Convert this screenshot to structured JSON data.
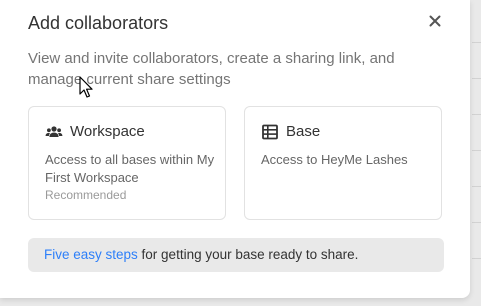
{
  "dialog": {
    "title": "Add collaborators",
    "close_icon": "close-icon",
    "description": "View and invite collaborators, create a sharing link, and manage current share settings"
  },
  "options": [
    {
      "title": "Workspace",
      "icon": "people-icon",
      "description": "Access to all bases within My First Workspace",
      "note": "Recommended"
    },
    {
      "title": "Base",
      "icon": "grid-table-icon",
      "description": "Access to HeyMe Lashes"
    }
  ],
  "banner": {
    "link_text": "Five easy steps",
    "rest_text": " for getting your base ready to share."
  },
  "colors": {
    "link": "#2d7ff9",
    "banner_bg": "#e9e9e9",
    "card_border": "#e2e2e2"
  }
}
